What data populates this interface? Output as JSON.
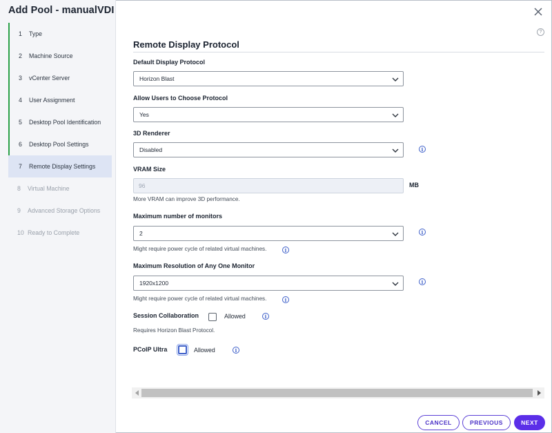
{
  "wizard": {
    "title": "Add Pool - manualVDI"
  },
  "steps": [
    {
      "num": "1",
      "label": "Type",
      "state": "done"
    },
    {
      "num": "2",
      "label": "Machine Source",
      "state": "done"
    },
    {
      "num": "3",
      "label": "vCenter Server",
      "state": "done"
    },
    {
      "num": "4",
      "label": "User Assignment",
      "state": "done"
    },
    {
      "num": "5",
      "label": "Desktop Pool Identification",
      "state": "done"
    },
    {
      "num": "6",
      "label": "Desktop Pool Settings",
      "state": "done"
    },
    {
      "num": "7",
      "label": "Remote Display Settings",
      "state": "active"
    },
    {
      "num": "8",
      "label": "Virtual Machine",
      "state": "pending"
    },
    {
      "num": "9",
      "label": "Advanced Storage Options",
      "state": "pending"
    },
    {
      "num": "10",
      "label": "Ready to Complete",
      "state": "pending"
    }
  ],
  "header": {
    "help_glyph": "?"
  },
  "section": {
    "title": "Remote Display Protocol"
  },
  "form": {
    "default_protocol": {
      "label": "Default Display Protocol",
      "value": "Horizon Blast"
    },
    "allow_choose": {
      "label": "Allow Users to Choose Protocol",
      "value": "Yes"
    },
    "renderer": {
      "label": "3D Renderer",
      "value": "Disabled"
    },
    "vram": {
      "label": "VRAM Size",
      "value": "96",
      "unit": "MB",
      "helper": "More VRAM can improve 3D performance."
    },
    "monitors": {
      "label": "Maximum number of monitors",
      "value": "2",
      "helper": "Might require power cycle of related virtual machines."
    },
    "resolution": {
      "label": "Maximum Resolution of Any One Monitor",
      "value": "1920x1200",
      "helper": "Might require power cycle of related virtual machines."
    },
    "session_collab": {
      "label": "Session Collaboration",
      "checkbox_label": "Allowed",
      "checked": false,
      "helper": "Requires Horizon Blast Protocol."
    },
    "pcoip_ultra": {
      "label": "PCoIP Ultra",
      "checkbox_label": "Allowed",
      "checked": false
    }
  },
  "info_glyph": "i",
  "footer": {
    "cancel": "CANCEL",
    "previous": "PREVIOUS",
    "next": "NEXT"
  },
  "colors": {
    "accent": "#5b2ee8",
    "step_done": "#2aa148",
    "info": "#3d5fc9"
  },
  "icons": {
    "close": "close-icon",
    "chevron": "chevron-down-icon",
    "info": "info-icon",
    "help": "help-icon"
  }
}
